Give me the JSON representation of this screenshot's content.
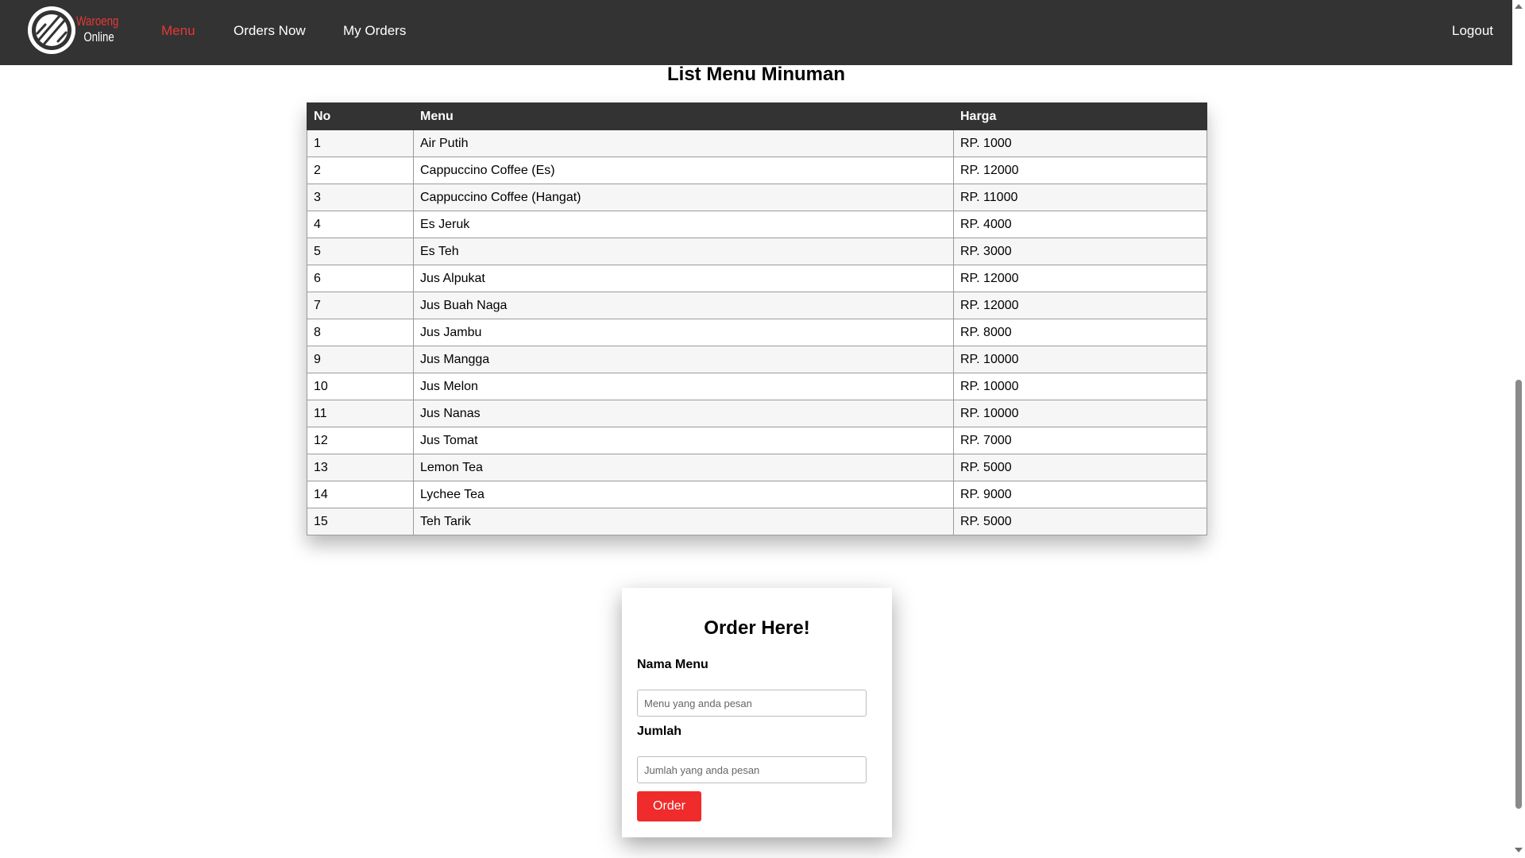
{
  "navbar": {
    "logo": {
      "line1": "Waroeng",
      "line2": "Online",
      "accent_color": "#e53935",
      "icon": "fork-knife-plate-icon"
    },
    "links": {
      "menu": "Menu",
      "orders_now": "Orders Now",
      "my_orders": "My Orders",
      "logout": "Logout"
    },
    "active": "Menu",
    "background": "#333333"
  },
  "list": {
    "title": "List Menu Minuman",
    "columns": {
      "no": "No",
      "menu": "Menu",
      "harga": "Harga"
    },
    "rows": [
      {
        "no": "1",
        "menu": "Air Putih",
        "harga": "RP. 1000"
      },
      {
        "no": "2",
        "menu": "Cappuccino Coffee (Es)",
        "harga": "RP. 12000"
      },
      {
        "no": "3",
        "menu": "Cappuccino Coffee (Hangat)",
        "harga": "RP. 11000"
      },
      {
        "no": "4",
        "menu": "Es Jeruk",
        "harga": "RP. 4000"
      },
      {
        "no": "5",
        "menu": "Es Teh",
        "harga": "RP. 3000"
      },
      {
        "no": "6",
        "menu": "Jus Alpukat",
        "harga": "RP. 12000"
      },
      {
        "no": "7",
        "menu": "Jus Buah Naga",
        "harga": "RP. 12000"
      },
      {
        "no": "8",
        "menu": "Jus Jambu",
        "harga": "RP. 8000"
      },
      {
        "no": "9",
        "menu": "Jus Mangga",
        "harga": "RP. 10000"
      },
      {
        "no": "10",
        "menu": "Jus Melon",
        "harga": "RP. 10000"
      },
      {
        "no": "11",
        "menu": "Jus Nanas",
        "harga": "RP. 10000"
      },
      {
        "no": "12",
        "menu": "Jus Tomat",
        "harga": "RP. 7000"
      },
      {
        "no": "13",
        "menu": "Lemon Tea",
        "harga": "RP. 5000"
      },
      {
        "no": "14",
        "menu": "Lychee Tea",
        "harga": "RP. 9000"
      },
      {
        "no": "15",
        "menu": "Teh Tarik",
        "harga": "RP. 5000"
      }
    ]
  },
  "order_form": {
    "title": "Order Here!",
    "nama_label": "Nama Menu",
    "nama_placeholder": "Menu yang anda pesan",
    "nama_value": "",
    "jumlah_label": "Jumlah",
    "jumlah_placeholder": "Jumlah yang anda pesan",
    "jumlah_value": "",
    "submit_label": "Order",
    "button_color": "#ef2b2b"
  }
}
